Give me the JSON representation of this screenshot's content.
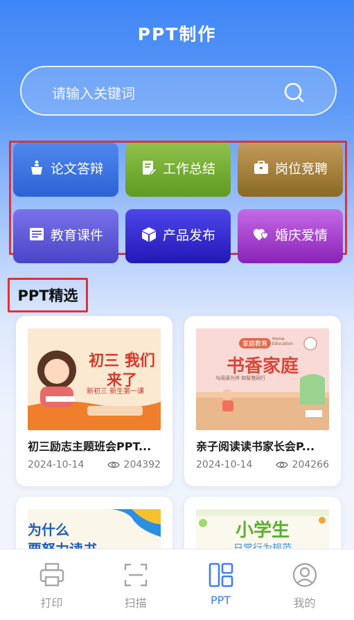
{
  "header": {
    "title": "PPT制作"
  },
  "search": {
    "placeholder": "请输入关键词"
  },
  "categories": [
    {
      "label": "论文答辩",
      "icon": "podium-icon"
    },
    {
      "label": "工作总结",
      "icon": "document-edit-icon"
    },
    {
      "label": "岗位竞聘",
      "icon": "briefcase-icon"
    },
    {
      "label": "教育课件",
      "icon": "courseware-icon"
    },
    {
      "label": "产品发布",
      "icon": "box-icon"
    },
    {
      "label": "婚庆爱情",
      "icon": "hearts-icon"
    }
  ],
  "section": {
    "title": "PPT精选"
  },
  "cards": [
    {
      "title": "初三励志主题班会PPT...",
      "date": "2024-10-14",
      "views": "204392",
      "thumb_text": "初三 我们来了",
      "thumb_sub": "新初三 新生第一课"
    },
    {
      "title": "亲子阅读读书家长会P...",
      "date": "2024-10-14",
      "views": "204266",
      "thumb_text": "书香家庭",
      "thumb_top1": "家庭教育",
      "thumb_top2": "Home Education",
      "thumb_sub": "与阅读为伴 和智慧同行"
    },
    {
      "thumb_text": "为什么",
      "thumb_sub": "要努力读书"
    },
    {
      "thumb_text": "小学生",
      "thumb_sub": "日常行为规范"
    }
  ],
  "tabbar": [
    {
      "label": "打印",
      "icon": "printer-icon",
      "active": false
    },
    {
      "label": "扫描",
      "icon": "scan-icon",
      "active": false
    },
    {
      "label": "PPT",
      "icon": "layout-icon",
      "active": true
    },
    {
      "label": "我的",
      "icon": "user-icon",
      "active": false
    }
  ],
  "colors": {
    "accent": "#3f7ef0",
    "highlight_border": "#e0303a"
  }
}
